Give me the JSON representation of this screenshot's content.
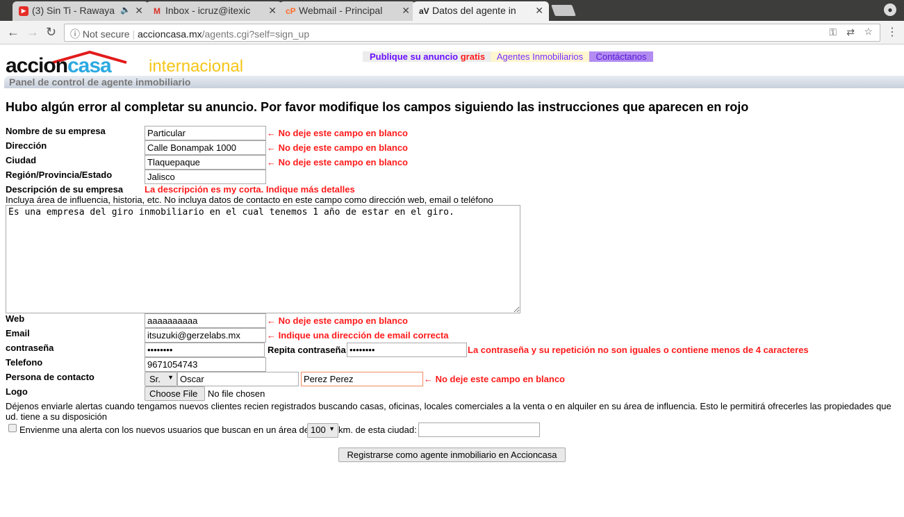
{
  "browser": {
    "tabs": [
      {
        "title": "(3) Sin Ti - Rawaya",
        "icon": "youtube-icon",
        "color": "#e52d27"
      },
      {
        "title": "Inbox - icruz@itexic",
        "icon": "gmail-icon",
        "color": "#d93025"
      },
      {
        "title": "Webmail - Principal",
        "icon": "cpanel-icon",
        "color": "#ff6c2c"
      },
      {
        "title": "Datos del agente in",
        "icon": "accioncasa-icon",
        "color": "#222"
      }
    ],
    "security": "Not secure",
    "url_domain": "accioncasa.mx",
    "url_path": "/agents.cgi?self=sign_up"
  },
  "site": {
    "logo_accion": "accion",
    "logo_casa": "casa",
    "logo_sub": "internacional",
    "nav": {
      "publish": "Publique su anuncio ",
      "publish_free": "gratis",
      "agents": "Agentes Inmobiliarios",
      "contact": "Contáctanos"
    },
    "panel_title": "Panel de control de agente inmobiliario"
  },
  "form": {
    "error_heading": "Hubo algún error al completar su anuncio. Por favor modifique los campos siguiendo las instrucciones que aparecen en rojo",
    "company_label": "Nombre de su empresa",
    "company_value": "Particular",
    "company_error": "← No deje este campo en blanco",
    "address_label": "Dirección",
    "address_value": "Calle Bonampak 1000",
    "address_error": "← No deje este campo en blanco",
    "city_label": "Ciudad",
    "city_value": "Tlaquepaque",
    "city_error": "← No deje este campo en blanco",
    "region_label": "Región/Provincia/Estado",
    "region_value": "Jalisco",
    "desc_label": "Descripción de su empresa",
    "desc_error": "La descripción es my corta. Indique más detalles",
    "desc_hint": "Incluya área de influencia, historia, etc. No incluya datos de contacto en este campo como dirección web, email o teléfono",
    "desc_value": "Es una empresa del giro inmobiliario en el cual tenemos 1 año de estar en el giro.",
    "web_label": "Web",
    "web_value": "aaaaaaaaaa",
    "web_error": "← No deje este campo en blanco",
    "email_label": "Email",
    "email_value": "itsuzuki@gerzelabs.mx",
    "email_error": "← Indique una dirección de email correcta",
    "password_label": "contraseña",
    "password_value": "••••••••",
    "repeat_label": "Repita contraseña",
    "repeat_value": "••••••••",
    "password_error": "La contraseña y su repetición no son iguales o contiene menos de 4 caracteres",
    "phone_label": "Telefono",
    "phone_value": "9671054743",
    "contact_label": "Persona de contacto",
    "title_value": "Sr.",
    "first_name": "Oscar",
    "last_name": "Perez Perez",
    "contact_error": "← No deje este campo en blanco",
    "logo_label": "Logo",
    "choose_file": "Choose File",
    "no_file": "No file chosen",
    "alerts_text": "Déjenos enviarle alertas cuando tengamos nuevos clientes recien registrados buscando casas, oficinas, locales comerciales a la venta o en alquiler en su área de influencia. Esto le permitirá ofrecerles las propiedades que ud. tiene a su disposición",
    "alert_checkbox_label": "Envienme una alerta con los nuevos usuarios que buscan en un área de",
    "radius_value": "100",
    "radius_suffix": "km. de esta ciudad:",
    "city_alert_value": "",
    "alert_checked": false,
    "submit": "Registrarse como agente inmobiliario en Accioncasa"
  }
}
